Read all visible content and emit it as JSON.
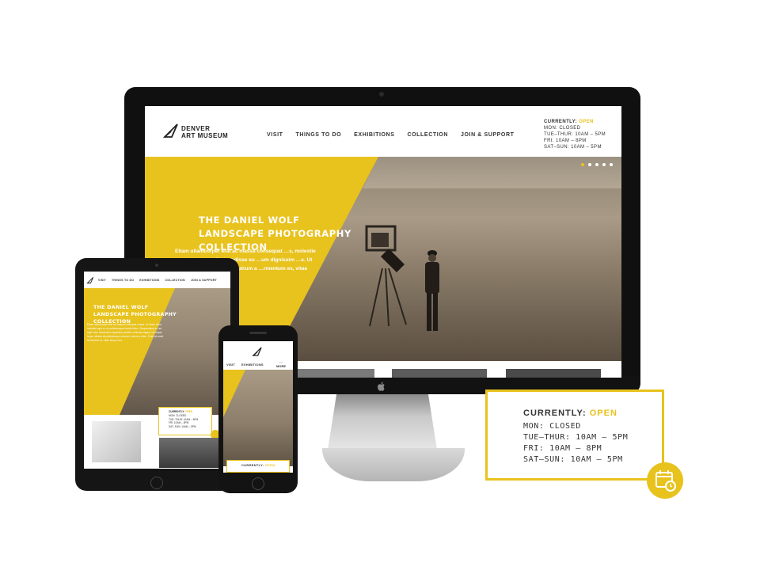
{
  "desktop": {
    "logo_line1": "DENVER",
    "logo_line2": "ART MUSEUM",
    "nav": [
      "VISIT",
      "THINGS TO DO",
      "EXHIBITIONS",
      "COLLECTION",
      "JOIN & SUPPORT"
    ],
    "hours": {
      "currently_label": "CURRENTLY:",
      "status": "OPEN",
      "lines": [
        "MON: CLOSED",
        "TUE–THUR: 10AM – 5PM",
        "FRI: 10AM – 8PM",
        "SAT–SUN: 10AM – 5PM"
      ]
    },
    "hero_title": "THE DANIEL WOLF LANDSCAPE PHOTOGRAPHY COLLECTION",
    "hero_body": "Etiam ullamcorper erat ac massa consequat …s, molestie eget ex at, …us. Suspendisse eu …um dignissim …s. Ut neque turpis, …sit amet, rutrum a …rmentum ex, vitae",
    "slider_dots": 5,
    "slider_active": 0
  },
  "tablet": {
    "nav": [
      "VISIT",
      "THINGS TO DO",
      "EXHIBITIONS",
      "COLLECTION",
      "JOIN & SUPPORT"
    ],
    "hero_title": "THE DANIEL WOLF LANDSCAPE PHOTOGRAPHY COLLECTION",
    "hero_body": "Etiam ullamcorper erat ac massa consequat ornare. Ut lorem risus, molestie eget ex at, pellentesque iaculis tellus. Suspendisse eu leo eget enim elementum dignissim porttitor vehicula magna. Ut neque turpis, dictum at pellentesque sit amet, rutrum a dolor. Proin sit amet fermentum ex, vitae tempor leo.",
    "hours": {
      "currently_label": "CURRENTLY:",
      "status": "OPEN",
      "lines": [
        "MON: CLOSED",
        "TUE–THUR: 10AM – 5PM",
        "FRI: 10AM – 8PM",
        "SAT–SUN: 10AM – 5PM"
      ]
    }
  },
  "phone": {
    "nav": [
      "VISIT",
      "EXHIBITIONS"
    ],
    "more_label": "MORE",
    "hours_currently_label": "CURRENTLY:",
    "hours_status": "OPEN"
  },
  "callout": {
    "currently_label": "CURRENTLY:",
    "status": "OPEN",
    "lines": [
      "MON: CLOSED",
      "TUE–THUR: 10AM – 5PM",
      "FRI: 10AM – 8PM",
      "SAT–SUN: 10AM – 5PM"
    ]
  },
  "colors": {
    "accent": "#e8c21d",
    "device": "#111111",
    "text": "#333333"
  }
}
